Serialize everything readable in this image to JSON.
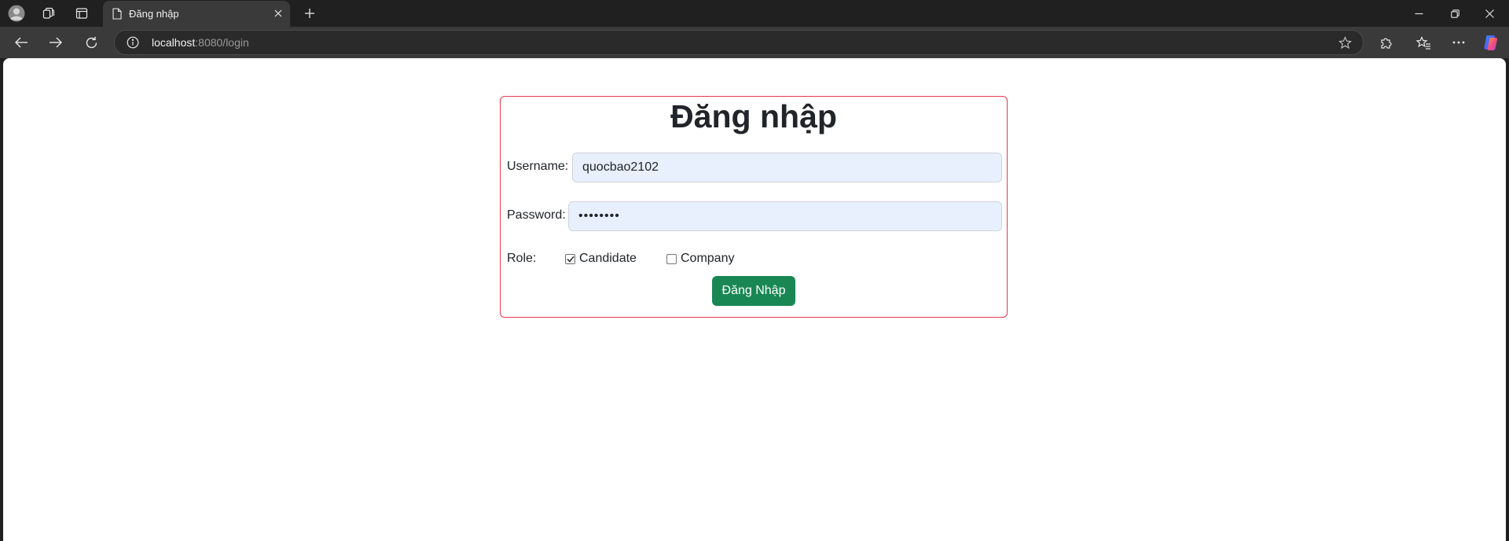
{
  "browser": {
    "tab_title": "Đăng nhập",
    "address": {
      "host": "localhost",
      "path": ":8080/login"
    },
    "icons": {
      "profile": "avatar-icon",
      "workspaces": "workspaces-icon",
      "tab_actions": "tab-actions-icon",
      "page": "page-icon",
      "close": "close-icon",
      "new_tab": "plus-icon",
      "back": "back-arrow-icon",
      "forward": "forward-arrow-icon",
      "refresh": "refresh-icon",
      "site_info": "info-icon",
      "favorite": "star-icon",
      "extensions": "puzzle-icon",
      "favorites": "favorites-icon",
      "more": "more-icon",
      "copilot": "copilot-icon"
    }
  },
  "login": {
    "title": "Đăng nhập",
    "username_label": "Username:",
    "username_value": "quocbao2102",
    "password_label": "Password:",
    "password_value": "••••••••",
    "role_label": "Role:",
    "roles": [
      {
        "label": "Candidate",
        "checked": true
      },
      {
        "label": "Company",
        "checked": false
      }
    ],
    "submit_label": "Đăng Nhập"
  },
  "colors": {
    "card_border": "#e8394f",
    "button_bg": "#198754",
    "input_bg": "#e8f0fe"
  }
}
